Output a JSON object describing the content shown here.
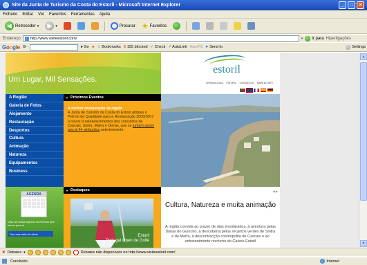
{
  "window": {
    "title": "Site da Junta de Turismo da Costa do Estoril - Microsoft Internet Explorer"
  },
  "menu": [
    "Ficheiro",
    "Editar",
    "Ver",
    "Favoritos",
    "Ferramentas",
    "Ajuda"
  ],
  "toolbar": {
    "back": "Retroceder",
    "search": "Procurar",
    "favorites": "Favoritos"
  },
  "address": {
    "label": "Endereço",
    "url": "http://www.visiteestoril.com/",
    "go": "Ir para",
    "links": "Hiperligações"
  },
  "googlebar": {
    "logo": "Google",
    "logo_suffix": "G-",
    "go": "Go",
    "bookmarks": "Bookmarks",
    "blocked": "155 blocked",
    "check": "Check",
    "autolink": "AutoLink",
    "autofill": "AutoFill",
    "sendto": "Send to",
    "settings": "Settings"
  },
  "site": {
    "slogan": "Um Lugar, Mil Sensações.",
    "logo": "estoril",
    "toplinks": [
      "CHRONOLOGIA",
      "ESTORIL",
      "CONTACTOS",
      "MAPA DO SITE"
    ],
    "nav": [
      "A Região",
      "Galeria de Fotos",
      "Alojamento",
      "Restauração",
      "Desportos",
      "Cultura",
      "Animação",
      "Natureza",
      "Equipamentos",
      "Business"
    ],
    "agenda": {
      "title": "AGENDA",
      "text": "Veja na nossa agenda os eventos que temos para si",
      "button": "Dar uma vista de olhos"
    },
    "events": {
      "header": "Próximos Eventos",
      "title": "A melhor restauração da região",
      "body": "A Junta de Turismo da Costa do Estoril atribuiu o Prémio de Qualidade para a Restauração 2006/2007 a novos 9 estabelecimentos dos concelhos de Cascais, Sintra, Mafra e Oeiras, que se",
      "link": "juntam assim aos já 44 atribuídos",
      "tail": "anteriormente."
    },
    "highlights": {
      "header": "Destaques",
      "caption_top": "Estoril",
      "caption_bottom": "Portugal Open de Golfe"
    },
    "feature": {
      "arrows": "◀ ▶",
      "headline": "Cultura, Natureza e muita animação",
      "text": "A região convida ao prazer de dias ensolarados, à aventura pelas dunas do Guincho, à descoberta pelos recantos verdes de Sintra e de Mafra, à descontracção cosmopolita de Cascais e ao entretenimento nocturno do Casino Estoril"
    }
  },
  "debatesbar": {
    "label": "Debates",
    "status": "Debates não disponíveis no http://www.visiteestoril.com/"
  },
  "status": {
    "text": "Concluído",
    "zone": "Internet"
  },
  "colors": {
    "nav_blue": "#0a4ea6",
    "orange": "#f8a81a",
    "ie_blue": "#2458c8"
  }
}
